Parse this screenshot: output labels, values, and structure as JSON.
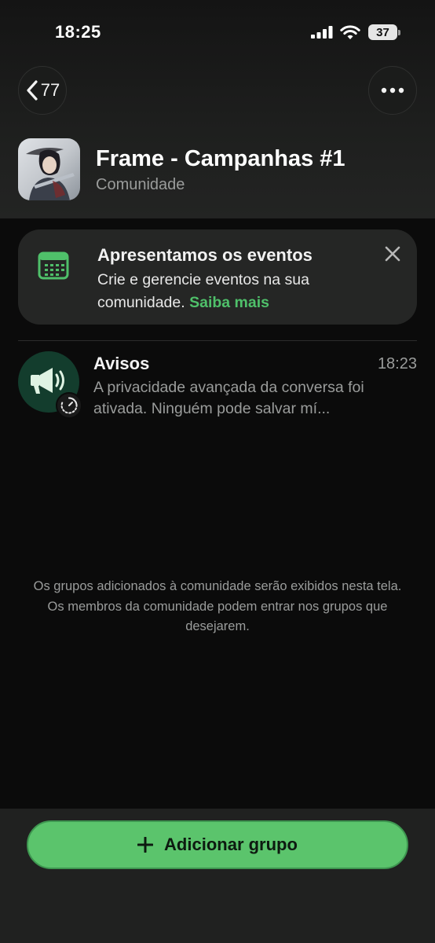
{
  "status_bar": {
    "time": "18:25",
    "battery": "37"
  },
  "nav": {
    "back_count": "77"
  },
  "community": {
    "title": "Frame - Campanhas #1",
    "subtitle": "Comunidade"
  },
  "events_card": {
    "title": "Apresentamos os eventos",
    "body": "Crie e gerencie eventos na sua comunidade.",
    "link": "Saiba mais"
  },
  "announcements": {
    "name": "Avisos",
    "time": "18:23",
    "preview": "A privacidade avançada da conversa foi ativada. Ninguém pode salvar mí..."
  },
  "info": {
    "line1": "Os grupos adicionados à comunidade serão exibidos nesta tela.",
    "line2": "Os membros da comunidade podem entrar nos grupos que desejarem."
  },
  "bottom": {
    "add_group_label": "Adicionar grupo"
  },
  "colors": {
    "accent": "#5bc46c",
    "link": "#4fc06a",
    "background": "#0b0b0b"
  },
  "icons": [
    "chevron-left-icon",
    "more-icon",
    "calendar-icon",
    "close-icon",
    "megaphone-icon",
    "timer-icon",
    "plus-icon",
    "signal-icon",
    "wifi-icon",
    "battery-icon"
  ]
}
